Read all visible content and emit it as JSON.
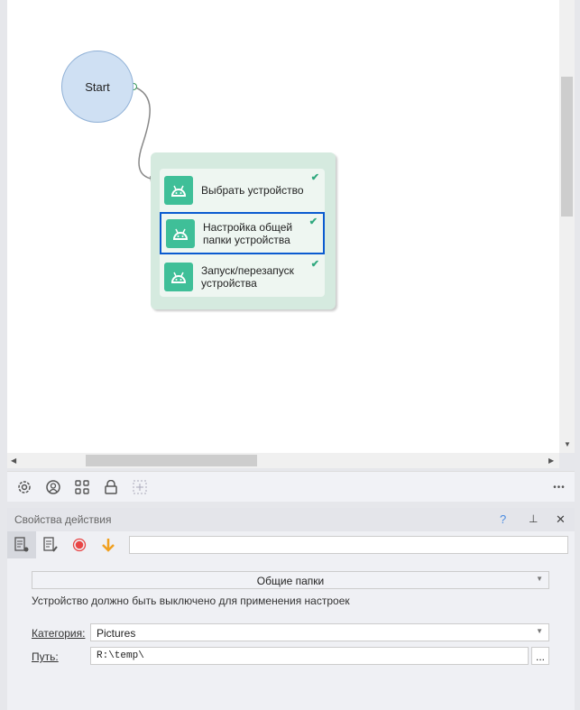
{
  "canvas": {
    "start_label": "Start",
    "nodes": [
      {
        "label": "Выбрать устройство",
        "selected": false
      },
      {
        "label": "Настройка общей папки устройства",
        "selected": true
      },
      {
        "label": "Запуск/перезапуск устройства",
        "selected": false
      }
    ]
  },
  "toolbar": {
    "icons": [
      "gear-icon",
      "user-circle-icon",
      "grid-icon",
      "lock-icon",
      "add-frame-icon"
    ],
    "more": "•••"
  },
  "panel": {
    "title": "Свойства действия",
    "help": "?",
    "pin": "⊥",
    "close": "✕",
    "search_value": "",
    "mode_select": "Общие папки",
    "notice": "Устройство должно быть выключено для применения настроек",
    "category_label": "Категория:",
    "category_value": "Pictures",
    "path_label": "Путь:",
    "path_value": "R:\\temp\\",
    "browse": "..."
  },
  "colors": {
    "accent": "#3fbf98",
    "selection": "#0a5bd0"
  }
}
